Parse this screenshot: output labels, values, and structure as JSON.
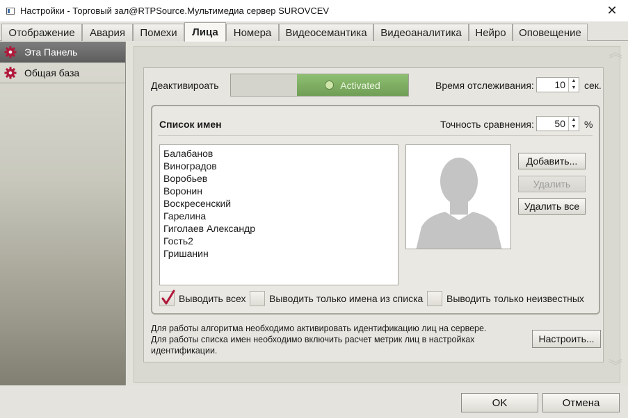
{
  "window": {
    "title": "Настройки - Торговый зал@RTPSource.Мультимедиа сервер SUROVCEV",
    "close_glyph": "✕"
  },
  "tabs": [
    {
      "label": "Отображение",
      "active": false
    },
    {
      "label": "Авария",
      "active": false
    },
    {
      "label": "Помехи",
      "active": false
    },
    {
      "label": "Лица",
      "active": true
    },
    {
      "label": "Номера",
      "active": false
    },
    {
      "label": "Видеосемантика",
      "active": false
    },
    {
      "label": "Видеоаналитика",
      "active": false
    },
    {
      "label": "Нейро",
      "active": false
    },
    {
      "label": "Оповещение",
      "active": false
    }
  ],
  "sidebar": {
    "items": [
      {
        "label": "Эта Панель",
        "active": true,
        "icon": "gear-icon"
      },
      {
        "label": "Общая база",
        "active": false,
        "icon": "gear-icon"
      }
    ]
  },
  "main": {
    "deactivate_label": "Деактивироать",
    "toggle_state_label": "Activated",
    "tracking_time_label": "Время отслеживания:",
    "tracking_time_value": "10",
    "tracking_time_unit": "сек.",
    "names_group": {
      "title": "Список имен",
      "accuracy_label": "Точность сравнения:",
      "accuracy_value": "50",
      "accuracy_unit": "%",
      "names": [
        "Балабанов",
        "Виноградов",
        "Воробьев",
        "Воронин",
        "Воскресенский",
        "Гарелина",
        "Гиголаев Александр",
        "Гость2",
        "Гришанин"
      ],
      "buttons": {
        "add": "Добавить...",
        "delete": "Удалить",
        "delete_all": "Удалить все"
      },
      "checkboxes": [
        {
          "label": "Выводить всех",
          "checked": true
        },
        {
          "label": "Выводить только имена из списка",
          "checked": false
        },
        {
          "label": "Выводить только неизвестных",
          "checked": false
        }
      ]
    },
    "info_lines": [
      "Для работы алгоритма необходимо активировать идентификацию лиц на сервере.",
      "Для работы списка имен необходимо включить расчет метрик лиц в настройках",
      "идентификации."
    ],
    "configure_button": "Настроить..."
  },
  "footer": {
    "ok": "OK",
    "cancel": "Отмена"
  },
  "colors": {
    "toggle_on": "#7aab5f",
    "check_mark": "#b0183a",
    "sidebar_gear": "#b0183a"
  }
}
